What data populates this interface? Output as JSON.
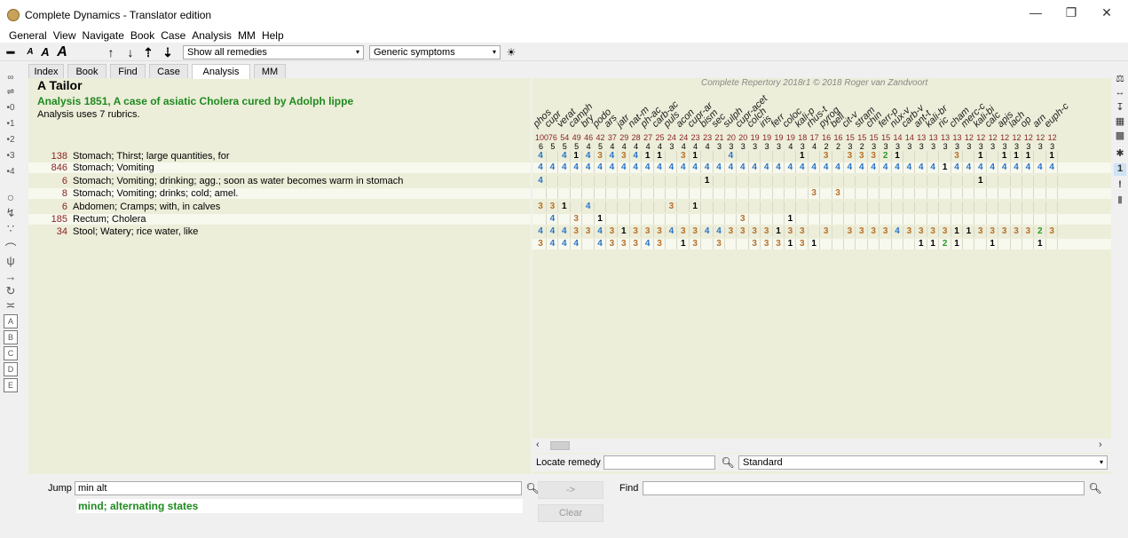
{
  "window": {
    "title": "Complete Dynamics - Translator edition",
    "minimize_glyph": "—",
    "restore_glyph": "❐",
    "close_glyph": "✕"
  },
  "menu": [
    "General",
    "View",
    "Navigate",
    "Book",
    "Case",
    "Analysis",
    "MM",
    "Help"
  ],
  "toolbar": {
    "remedy_filter": "Show all remedies",
    "symptom_filter": "Generic symptoms"
  },
  "tabs": [
    "Index",
    "Book",
    "Find",
    "Case",
    "Analysis",
    "MM"
  ],
  "active_tab": "Analysis",
  "case": {
    "title": "A Tailor",
    "analysis_title": "Analysis 1851, A case of asiatic Cholera cured by Adolph lippe",
    "analysis_subtitle": "Analysis uses 7 rubrics."
  },
  "rubrics": [
    {
      "count": "138",
      "text": "Stomach; Thirst; large quantities, for"
    },
    {
      "count": "846",
      "text": "Stomach; Vomiting"
    },
    {
      "count": "6",
      "text": "Stomach; Vomiting; drinking; agg.; soon as water becomes warm in stomach"
    },
    {
      "count": "8",
      "text": "Stomach; Vomiting; drinks; cold; amel."
    },
    {
      "count": "6",
      "text": "Abdomen; Cramps; with, in calves"
    },
    {
      "count": "185",
      "text": "Rectum; Cholera"
    },
    {
      "count": "34",
      "text": "Stool; Watery; rice water, like"
    }
  ],
  "copyright": "Complete Repertory 2018r1 © 2018 Roger van Zandvoort",
  "remedies": [
    "phos",
    "cupr",
    "verat",
    "camph",
    "bry",
    "podo",
    "ars",
    "jatr",
    "nat-m",
    "ph-ac",
    "carb-ac",
    "puls",
    "acon",
    "cupr-ar",
    "bism",
    "sec",
    "sulph",
    "cupr-acet",
    "colch",
    "iris",
    "ferr",
    "coloc",
    "kali-p",
    "rhus-t",
    "pyrog",
    "bell",
    "cit-v",
    "stram",
    "chin",
    "ferr-p",
    "nux-v",
    "carb-v",
    "ant-t",
    "kali-br",
    "ric",
    "cham",
    "merc-c",
    "kali-bi",
    "calc",
    "apis",
    "lach",
    "op",
    "arn",
    "euph-c"
  ],
  "totals": [
    "100",
    "76",
    "54",
    "49",
    "46",
    "42",
    "37",
    "29",
    "28",
    "27",
    "25",
    "24",
    "24",
    "23",
    "23",
    "21",
    "20",
    "20",
    "19",
    "19",
    "19",
    "19",
    "18",
    "17",
    "16",
    "16",
    "15",
    "15",
    "15",
    "15",
    "14",
    "14",
    "13",
    "13",
    "13",
    "13",
    "12",
    "12",
    "12",
    "12",
    "12",
    "12",
    "12",
    "12"
  ],
  "rubric_counts": [
    "6",
    "5",
    "5",
    "5",
    "4",
    "5",
    "4",
    "4",
    "4",
    "4",
    "4",
    "3",
    "4",
    "4",
    "4",
    "3",
    "3",
    "3",
    "3",
    "3",
    "3",
    "4",
    "3",
    "4",
    "2",
    "2",
    "3",
    "2",
    "3",
    "3",
    "3",
    "3",
    "3",
    "3",
    "3",
    "3",
    "3",
    "3",
    "3",
    "3",
    "3",
    "3",
    "3",
    "3"
  ],
  "grid": [
    [
      "4",
      "",
      "4",
      "1",
      "4",
      "3",
      "4",
      "3",
      "4",
      "1",
      "1",
      "",
      "3",
      "1",
      "",
      "",
      "4",
      "",
      "",
      "",
      "",
      "",
      "1",
      "",
      "3",
      "",
      "3",
      "3",
      "3",
      "2",
      "1",
      "",
      "",
      "",
      "",
      "3",
      "",
      "1",
      "",
      "1",
      "1",
      "1",
      "",
      "1"
    ],
    [
      "4",
      "4",
      "4",
      "4",
      "4",
      "4",
      "4",
      "4",
      "4",
      "4",
      "4",
      "4",
      "4",
      "4",
      "4",
      "4",
      "4",
      "4",
      "4",
      "4",
      "4",
      "4",
      "4",
      "4",
      "4",
      "4",
      "4",
      "4",
      "4",
      "4",
      "4",
      "4",
      "4",
      "4",
      "1",
      "4",
      "4",
      "4",
      "4",
      "4",
      "4",
      "4",
      "4",
      "4"
    ],
    [
      "4",
      "",
      "",
      "",
      "",
      "",
      "",
      "",
      "",
      "",
      "",
      "",
      "",
      "",
      "1",
      "",
      "",
      "",
      "",
      "",
      "",
      "",
      "",
      "",
      "",
      "",
      "",
      "",
      "",
      "",
      "",
      "",
      "",
      "",
      "",
      "",
      "",
      "1",
      "",
      "",
      "",
      "",
      "",
      ""
    ],
    [
      "",
      "",
      "",
      "",
      "",
      "",
      "",
      "",
      "",
      "",
      "",
      "",
      "",
      "",
      "",
      "",
      "",
      "",
      "",
      "",
      "",
      "",
      "",
      "3",
      "",
      "3",
      "",
      "",
      "",
      "",
      "",
      "",
      "",
      "",
      "",
      "",
      "",
      "",
      "",
      "",
      "",
      "",
      "",
      ""
    ],
    [
      "3",
      "3",
      "1",
      "",
      "4",
      "",
      "",
      "",
      "",
      "",
      "",
      "3",
      "",
      "1",
      "",
      "",
      "",
      "",
      "",
      "",
      "",
      "",
      "",
      "",
      "",
      "",
      "",
      "",
      "",
      "",
      "",
      "",
      "",
      "",
      "",
      "",
      "",
      "",
      "",
      "",
      "",
      "",
      "",
      ""
    ],
    [
      "",
      "4",
      "",
      "3",
      "",
      "1",
      "",
      "",
      "",
      "",
      "",
      "",
      "",
      "",
      "",
      "",
      "",
      "3",
      "",
      "",
      "",
      "1",
      "",
      "",
      "",
      "",
      "",
      "",
      "",
      "",
      "",
      "",
      "",
      "",
      "",
      "",
      "",
      "",
      "",
      "",
      "",
      "",
      "",
      ""
    ],
    [
      "4",
      "4",
      "4",
      "3",
      "3",
      "4",
      "3",
      "1",
      "3",
      "3",
      "3",
      "4",
      "3",
      "3",
      "4",
      "4",
      "3",
      "3",
      "3",
      "3",
      "1",
      "3",
      "3",
      "",
      "3",
      "",
      "3",
      "3",
      "3",
      "3",
      "4",
      "3",
      "3",
      "3",
      "3",
      "1",
      "1",
      "3",
      "3",
      "3",
      "3",
      "3",
      "2",
      "3"
    ],
    [
      "3",
      "4",
      "4",
      "4",
      "",
      "4",
      "3",
      "3",
      "3",
      "4",
      "3",
      "",
      "1",
      "3",
      "",
      "3",
      "",
      "",
      "3",
      "3",
      "3",
      "1",
      "3",
      "1",
      "",
      "",
      "",
      "",
      "",
      "",
      "",
      "",
      "1",
      "1",
      "2",
      "1",
      "",
      "",
      "1",
      "",
      "",
      "",
      "1",
      ""
    ]
  ],
  "locate": {
    "label": "Locate remedy",
    "value": "",
    "mode": "Standard"
  },
  "jump": {
    "label": "Jump to",
    "value": "min alt",
    "suggestion": "mind; alternating states"
  },
  "find": {
    "label": "Find",
    "value": ""
  },
  "buttons": {
    "go": "->",
    "clear": "Clear"
  },
  "left_sidebar": [
    "∞",
    "⇌",
    "•0",
    "•1",
    "•2",
    "•3",
    "•4",
    "○",
    "↯",
    "∵",
    "⌒",
    "ψ",
    "→",
    "↻",
    "≍",
    "A",
    "B",
    "C",
    "D",
    "E"
  ],
  "right_sidebar": [
    "⚖",
    "↔",
    "↧",
    "▦",
    "▩",
    "✱",
    "1",
    "!",
    "▮"
  ]
}
